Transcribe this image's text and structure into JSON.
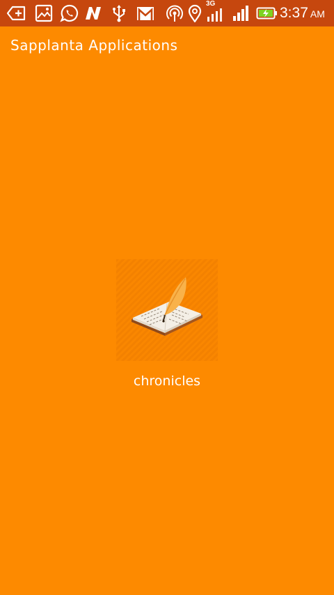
{
  "status_bar": {
    "background": "#C6470E",
    "icons": [
      "add-tab-icon",
      "image-icon",
      "whatsapp-icon",
      "n-app-icon",
      "usb-icon",
      "gmail-icon",
      "hotspot-icon",
      "location-icon",
      "signal-3g-icon",
      "signal-icon",
      "battery-charging-icon"
    ],
    "network_label": "3G",
    "time": "3:37",
    "ampm": "AM"
  },
  "header": {
    "title": "Sapplanta Applications"
  },
  "main": {
    "background": "#FD8A00",
    "app": {
      "label": "chronicles",
      "icon": "quill-book-icon"
    }
  }
}
